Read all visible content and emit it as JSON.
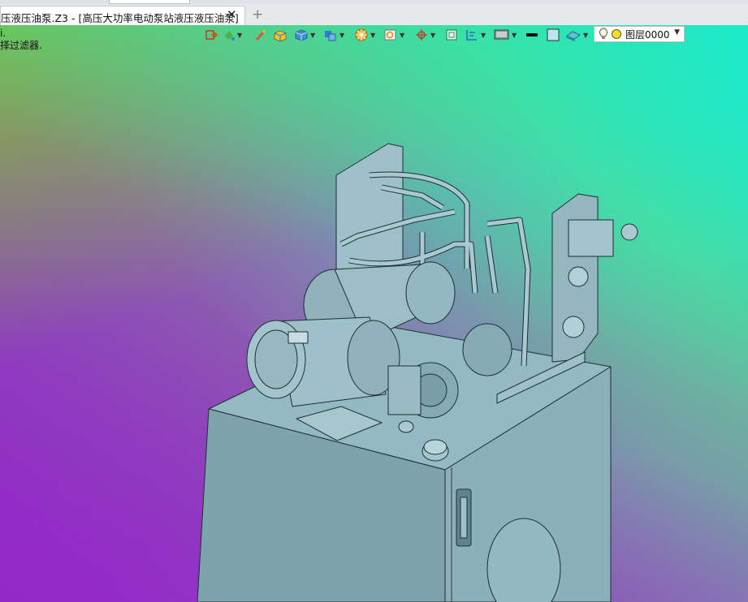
{
  "tabs": {
    "active_label": "压液压油泵.Z3 - [高压大功率电动泵站液压液压油泵]",
    "close_symbol": "✕",
    "new_tab_symbol": "+"
  },
  "prompt": {
    "line1": "i.",
    "line2": "择过滤器."
  },
  "toolbar": {
    "icons": [
      "exit-icon",
      "color-fill-icon",
      "pen-icon",
      "box-icon",
      "cube-icon",
      "cube-split-icon",
      "render-icon",
      "zoom-view-icon",
      "orient-icon",
      "frame-icon",
      "align-icon",
      "display-icon",
      "black-line-icon",
      "square-icon",
      "eraser-icon"
    ]
  },
  "layer": {
    "name": "图层0000",
    "bulb_color": "#f7e23a",
    "dot_color": "#f2dc2c"
  },
  "colors": {
    "model_fill": "#8ab4bf",
    "model_stroke": "#1f2e33"
  }
}
